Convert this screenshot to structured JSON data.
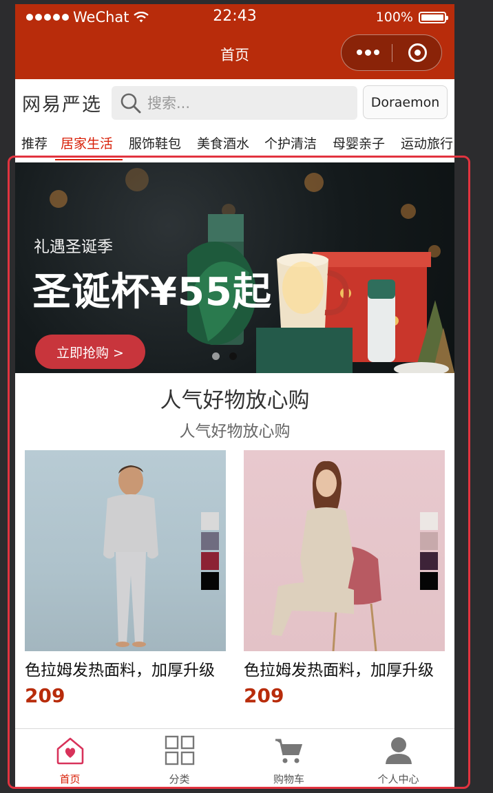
{
  "status_bar": {
    "carrier": "WeChat",
    "time": "22:43",
    "battery": "100%"
  },
  "nav": {
    "title": "首页",
    "more_icon": "more-dots-icon",
    "close_icon": "target-close-icon"
  },
  "search": {
    "logo": "网易严选",
    "placeholder": "搜索...",
    "user_button": "Doraemon"
  },
  "category_tabs": [
    {
      "label": "推荐",
      "active": false
    },
    {
      "label": "居家生活",
      "active": true
    },
    {
      "label": "服饰鞋包",
      "active": false
    },
    {
      "label": "美食酒水",
      "active": false
    },
    {
      "label": "个护清洁",
      "active": false
    },
    {
      "label": "母婴亲子",
      "active": false
    },
    {
      "label": "运动旅行",
      "active": false
    }
  ],
  "banner": {
    "subtitle": "礼遇圣诞季",
    "title": "圣诞杯¥55起",
    "button": "立即抢购 >",
    "slides": 2,
    "active_slide": 2
  },
  "section": {
    "title": "人气好物放心购",
    "subtitle": "人气好物放心购"
  },
  "products": [
    {
      "name": "色拉姆发热面料，加厚升级",
      "price": "209",
      "swatches": [
        "#d9d9d9",
        "#6f6c80",
        "#8c2234",
        "#050505"
      ]
    },
    {
      "name": "色拉姆发热面料，加厚升级",
      "price": "209",
      "swatches": [
        "#ece7e4",
        "#c7a9ab",
        "#3d2338",
        "#050505"
      ]
    }
  ],
  "tabbar": [
    {
      "label": "首页",
      "icon": "home-heart-icon",
      "active": true
    },
    {
      "label": "分类",
      "icon": "grid-icon",
      "active": false
    },
    {
      "label": "购物车",
      "icon": "cart-icon",
      "active": false
    },
    {
      "label": "个人中心",
      "icon": "person-icon",
      "active": false
    }
  ],
  "colors": {
    "brand": "#b82c0b",
    "accent": "#d81e06",
    "highlight": "#e2333f"
  }
}
